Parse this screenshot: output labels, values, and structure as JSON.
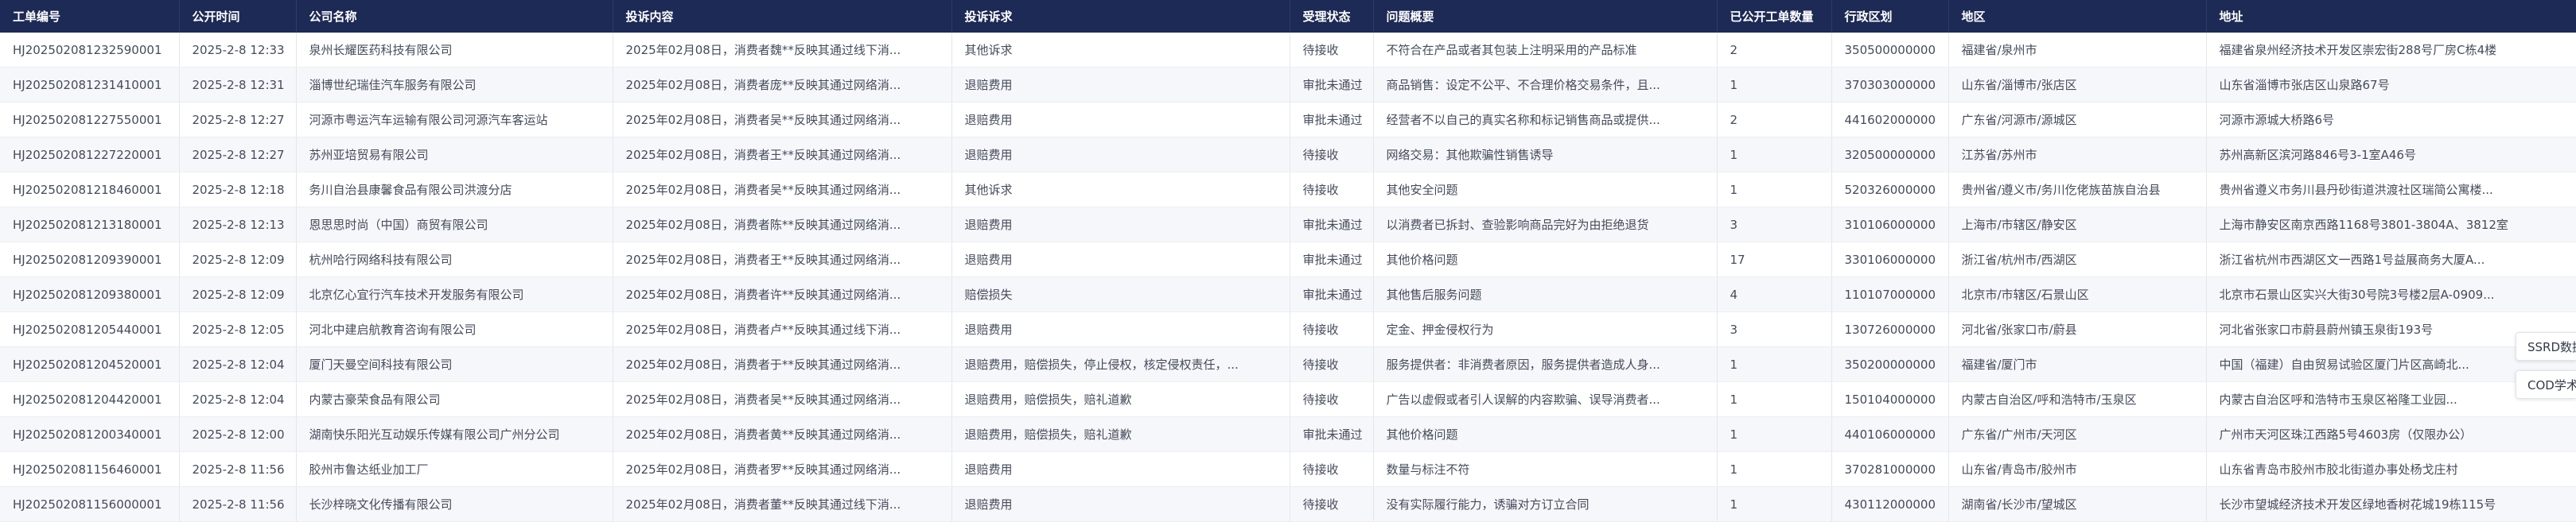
{
  "table": {
    "columns": [
      "工单编号",
      "公开时间",
      "公司名称",
      "投诉内容",
      "投诉诉求",
      "受理状态",
      "问题概要",
      "已公开工单数量",
      "行政区划",
      "地区",
      "地址"
    ],
    "rows": [
      [
        "HJ20250208123259000​1",
        "2025-2-8 12:33",
        "泉州长耀医药科技有限公司",
        "2025年02月08日，消费者魏**反映其通过线下消...",
        "其他诉求",
        "待接收",
        "不符合在产品或者其包装上注明采用的产品标准",
        "2",
        "350500000000",
        "福建省/泉州市",
        "福建省泉州经济技术开发区崇宏街288号厂房C栋4楼"
      ],
      [
        "HJ202502081231410001",
        "2025-2-8 12:31",
        "淄博世纪瑞佳汽车服务有限公司",
        "2025年02月08日，消费者庞**反映其通过网络消...",
        "退赔费用",
        "审批未通过",
        "商品销售：设定不公平、不合理价格交易条件，且...",
        "1",
        "370303000000",
        "山东省/淄博市/张店区",
        "山东省淄博市张店区山泉路67号"
      ],
      [
        "HJ202502081227550001",
        "2025-2-8 12:27",
        "河源市粤运汽车运输有限公司河源汽车客运站",
        "2025年02月08日，消费者吴**反映其通过网络消...",
        "退赔费用",
        "审批未通过",
        "经营者不以自己的真实名称和标记销售商品或提供...",
        "2",
        "441602000000",
        "广东省/河源市/源城区",
        "河源市源城大桥路6号"
      ],
      [
        "HJ202502081227220001",
        "2025-2-8 12:27",
        "苏州亚培贸易有限公司",
        "2025年02月08日，消费者王**反映其通过网络消...",
        "退赔费用",
        "待接收",
        "网络交易：其他欺骗性销售诱导",
        "1",
        "320500000000",
        "江苏省/苏州市",
        "苏州高新区滨河路846号3-1室A46号"
      ],
      [
        "HJ202502081218460001",
        "2025-2-8 12:18",
        "务川自治县康馨食品有限公司洪渡分店",
        "2025年02月08日，消费者吴**反映其通过网络消...",
        "其他诉求",
        "待接收",
        "其他安全问题",
        "1",
        "520326000000",
        "贵州省/遵义市/务川仡佬族苗族自治县",
        "贵州省遵义市务川县丹砂街道洪渡社区瑞简公寓楼..."
      ],
      [
        "HJ202502081213180001",
        "2025-2-8 12:13",
        "恩思思时尚（中国）商贸有限公司",
        "2025年02月08日，消费者陈**反映其通过网络消...",
        "退赔费用",
        "审批未通过",
        "以消费者已拆封、查验影响商品完好为由拒绝退货",
        "3",
        "310106000000",
        "上海市/市辖区/静安区",
        "上海市静安区南京西路1168号3801-3804A、3812室"
      ],
      [
        "HJ202502081209390001",
        "2025-2-8 12:09",
        "杭州哈行网络科技有限公司",
        "2025年02月08日，消费者王**反映其通过网络消...",
        "退赔费用",
        "审批未通过",
        "其他价格问题",
        "17",
        "330106000000",
        "浙江省/杭州市/西湖区",
        "浙江省杭州市西湖区文一西路1号益展商务大厦A..."
      ],
      [
        "HJ202502081209380001",
        "2025-2-8 12:09",
        "北京亿心宜行汽车技术开发服务有限公司",
        "2025年02月08日，消费者许**反映其通过网络消...",
        "赔偿损失",
        "审批未通过",
        "其他售后服务问题",
        "4",
        "110107000000",
        "北京市/市辖区/石景山区",
        "北京市石景山区实兴大街30号院3号楼2层A-0909..."
      ],
      [
        "HJ202502081205440001",
        "2025-2-8 12:05",
        "河北中建启航教育咨询有限公司",
        "2025年02月08日，消费者卢**反映其通过线下消...",
        "退赔费用",
        "待接收",
        "定金、押金侵权行为",
        "3",
        "130726000000",
        "河北省/张家口市/蔚县",
        "河北省张家口市蔚县蔚州镇玉泉街193号"
      ],
      [
        "HJ202502081204520001",
        "2025-2-8 12:04",
        "厦门天曼空间科技有限公司",
        "2025年02月08日，消费者于**反映其通过网络消...",
        "退赔费用，赔偿损失，停止侵权，核定侵权责任，...",
        "待接收",
        "服务提供者：非消费者原因，服务提供者造成人身...",
        "1",
        "350200000000",
        "福建省/厦门市",
        "中国（福建）自由贸易试验区厦门片区高崎北..."
      ],
      [
        "HJ202502081204420001",
        "2025-2-8 12:04",
        "内蒙古豪荣食品有限公司",
        "2025年02月08日，消费者吴**反映其通过网络消...",
        "退赔费用，赔偿损失，赔礼道歉",
        "待接收",
        "广告以虚假或者引人误解的内容欺骗、误导消费者...",
        "1",
        "150104000000",
        "内蒙古自治区/呼和浩特市/玉泉区",
        "内蒙古自治区呼和浩特市玉泉区裕隆工业园..."
      ],
      [
        "HJ202502081200340001",
        "2025-2-8 12:00",
        "湖南快乐阳光互动娱乐传媒有限公司广州分公司",
        "2025年02月08日，消费者黄**反映其通过网络消...",
        "退赔费用，赔偿损失，赔礼道歉",
        "审批未通过",
        "其他价格问题",
        "1",
        "440106000000",
        "广东省/广州市/天河区",
        "广州市天河区珠江西路5号4603房（仅限办公）"
      ],
      [
        "HJ202502081156460001",
        "2025-2-8 11:56",
        "胶州市鲁达纸业加工厂",
        "2025年02月08日，消费者罗**反映其通过网络消...",
        "退赔费用",
        "待接收",
        "数量与标注不符",
        "1",
        "370281000000",
        "山东省/青岛市/胶州市",
        "山东省青岛市胶州市胶北街道办事处杨戈庄村"
      ],
      [
        "HJ202502081156000001",
        "2025-2-8 11:56",
        "长沙梓晓文化传播有限公司",
        "2025年02月08日，消费者董**反映其通过线下消...",
        "退赔费用",
        "待接收",
        "没有实际履行能力，诱骗对方订立合同",
        "1",
        "430112000000",
        "湖南省/长沙市/望城区",
        "长沙市望城经济技术开发区绿地香树花城19栋115号"
      ]
    ]
  },
  "floating_tabs": [
    "SSRD数据",
    "COD学术"
  ]
}
